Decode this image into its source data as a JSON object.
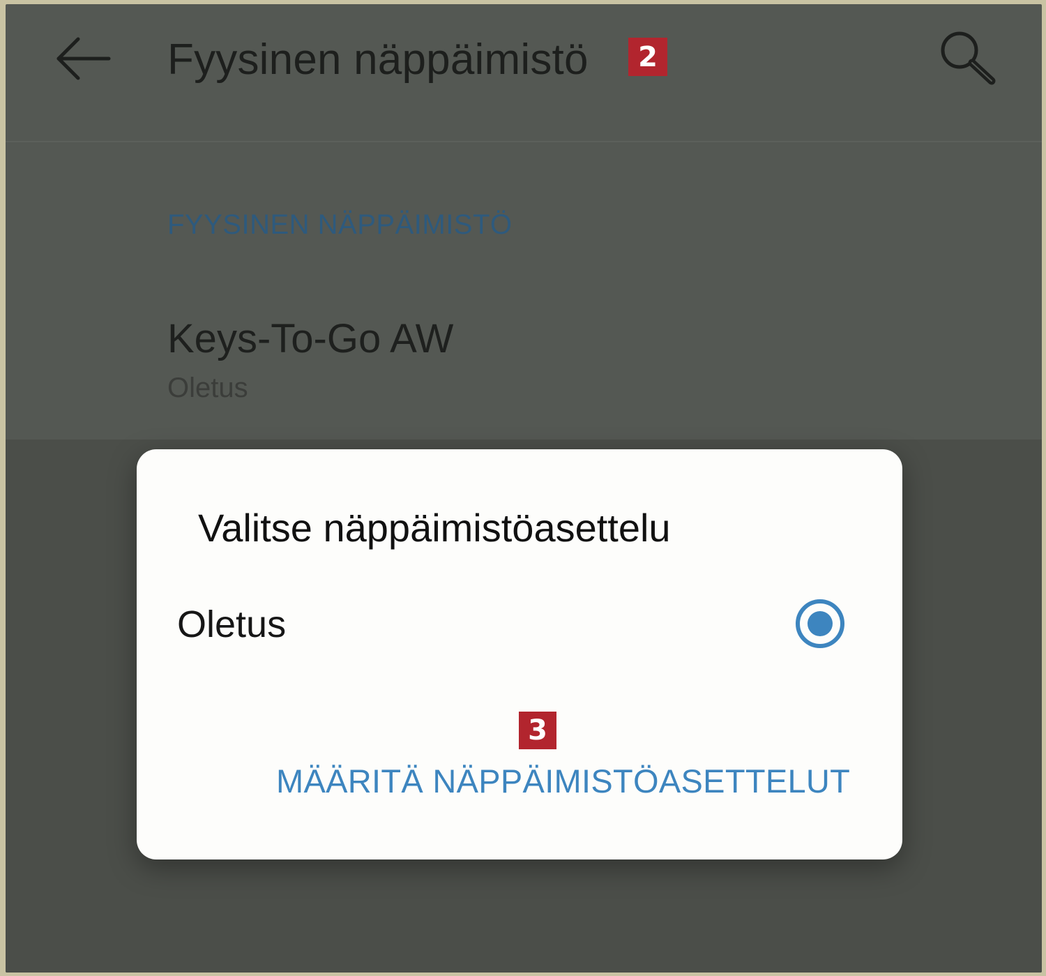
{
  "appbar": {
    "title": "Fyysinen näppäimistö",
    "back_icon": "arrow-left-icon",
    "search_icon": "search-icon",
    "step_badge": "2"
  },
  "section": {
    "header": "FYYSINEN NÄPPÄIMISTÖ"
  },
  "keyboard": {
    "name": "Keys-To-Go AW",
    "layout": "Oletus"
  },
  "dialog": {
    "title": "Valitse näppäimistöasettelu",
    "options": [
      {
        "label": "Oletus",
        "selected": true
      }
    ],
    "step_badge": "3",
    "action_label": "MÄÄRITÄ NÄPPÄIMISTÖASETTELUT"
  },
  "colors": {
    "accent": "#3d85bf",
    "badge": "#b2252e",
    "scrim": "#545853",
    "dialog_bg": "#fdfdfb"
  }
}
